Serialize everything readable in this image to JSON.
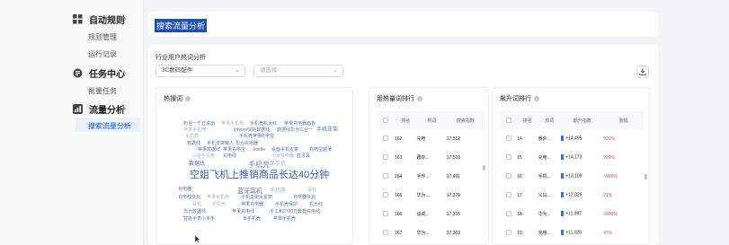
{
  "sidebar": {
    "sections": [
      {
        "label": "自动规则",
        "items": [
          "规则管理",
          "运行记录"
        ]
      },
      {
        "label": "任务中心",
        "items": [
          "批量任务"
        ]
      },
      {
        "label": "流量分析",
        "items": [
          "搜索流量分析"
        ]
      }
    ]
  },
  "header": {
    "title": "搜索流量分析"
  },
  "main": {
    "section_label": "行业用户热词分析",
    "category_select": "3C数码配件",
    "sub_select_placeholder": "请选择",
    "hot_words_title": "热搜词",
    "hot_words": [
      {
        "text": "粉丝一千万漫画",
        "size": 5,
        "color": "#5b73b8"
      },
      {
        "text": "苹果手机壳",
        "size": 5,
        "color": "#a9b4d6"
      },
      {
        "text": "手机壳机大红",
        "size": 5,
        "color": "#5b73b8"
      },
      {
        "text": "苹果充电器面板",
        "size": 5,
        "color": "#5b73b8"
      },
      {
        "text": "手机支架",
        "size": 6,
        "color": "#5b73b8"
      },
      {
        "text": "苹果手机壳",
        "size": 5,
        "color": "#a9b4d6"
      },
      {
        "text": "iphone快充数据线",
        "size": 5,
        "color": "#5b73b8"
      },
      {
        "text": "数据线华为三合一",
        "size": 5,
        "color": "#5b73b8"
      },
      {
        "text": "手机膜",
        "size": 5,
        "color": "#a9b4d6"
      },
      {
        "text": "手机壳苹果",
        "size": 5,
        "color": "#5b73b8"
      },
      {
        "text": "充电宝",
        "size": 5,
        "color": "#5b73b8"
      },
      {
        "text": "数据线",
        "size": 5,
        "color": "#5b73b8"
      },
      {
        "text": "手机支架懒人",
        "size": 5,
        "color": "#5b73b8"
      },
      {
        "text": "华为充电器",
        "size": 5,
        "color": "#5b73b8"
      },
      {
        "text": "苹果数据线",
        "size": 5,
        "color": "#5b73b8"
      },
      {
        "text": "苹果充电宝",
        "size": 5,
        "color": "#5b73b8"
      },
      {
        "text": "kindle",
        "size": 5,
        "color": "#5b73b8"
      },
      {
        "text": "桌面手机支架",
        "size": 5,
        "color": "#5b73b8"
      },
      {
        "text": "充电宝超薄",
        "size": 5,
        "color": "#5b73b8"
      },
      {
        "text": "三星手机壳",
        "size": 5,
        "color": "#a9b4d6"
      },
      {
        "text": "充电线",
        "size": 5,
        "color": "#5b73b8"
      },
      {
        "text": "小米充电器",
        "size": 5,
        "color": "#a9b4d6"
      },
      {
        "text": "蓝牙耳",
        "size": 5,
        "color": "#5b73b8"
      },
      {
        "text": "数据线",
        "size": 6,
        "color": "#5b73b8"
      },
      {
        "text": "手机壳",
        "size": 8,
        "color": "#6d83c2"
      },
      {
        "text": "苹果手机",
        "size": 6,
        "color": "#a9b4d6"
      },
      {
        "text": "空姐飞机上推销商品长达40分钟",
        "size": 11,
        "color": "#3d5fae"
      },
      {
        "text": "充电器",
        "size": 5,
        "color": "#5b73b8"
      },
      {
        "text": "蓝牙耳机",
        "size": 7,
        "color": "#5b73b8"
      },
      {
        "text": "手机膜",
        "size": 6,
        "color": "#a9b4d6"
      },
      {
        "text": "鼠标",
        "size": 5,
        "color": "#a9b4d6"
      },
      {
        "text": "充电线快充",
        "size": 5,
        "color": "#5b73b8"
      },
      {
        "text": "苹果手机壳",
        "size": 5,
        "color": "#a9b4d6"
      },
      {
        "text": "手机支架大支架",
        "size": 5,
        "color": "#5b73b8"
      },
      {
        "text": "充电器快充",
        "size": 5,
        "color": "#5b73b8"
      },
      {
        "text": "耳机",
        "size": 5,
        "color": "#a9b4d6"
      },
      {
        "text": "手机壳",
        "size": 5,
        "color": "#a9b4d6"
      },
      {
        "text": "苹果充电器",
        "size": 5,
        "color": "#5b73b8"
      },
      {
        "text": "手机壳保护",
        "size": 5,
        "color": "#5b73b8"
      },
      {
        "text": "机大红",
        "size": 5,
        "color": "#5b73b8"
      },
      {
        "text": "华为数据线",
        "size": 5,
        "color": "#5b73b8"
      },
      {
        "text": "苹果充电线",
        "size": 5,
        "color": "#5b73b8"
      },
      {
        "text": "手工和2700万套套充电线",
        "size": 5,
        "color": "#5b73b8"
      },
      {
        "text": "智能手表小米手",
        "size": 5,
        "color": "#5b73b8"
      },
      {
        "text": "单手机壳",
        "size": 5,
        "color": "#5b73b8"
      },
      {
        "text": "苹果手机壳",
        "size": 5,
        "color": "#5b73b8"
      }
    ],
    "search_rank": {
      "title": "用热量词排行",
      "headers": [
        "排名",
        "热词",
        "搜索指数"
      ],
      "rows": [
        {
          "rank": "162",
          "word": "充电",
          "index": "17,512"
        },
        {
          "rank": "163",
          "word": "跟你...",
          "index": "17,510"
        },
        {
          "rank": "164",
          "word": "手作...",
          "index": "17,491"
        },
        {
          "rank": "165",
          "word": "华为...",
          "index": "17,379"
        },
        {
          "rank": "166",
          "word": "谈戒...",
          "index": "17,315"
        },
        {
          "rank": "167",
          "word": "华为...",
          "index": "17,303"
        }
      ]
    },
    "rising_rank": {
      "title": "飙升词排行",
      "headers": [
        "排名",
        "热词",
        "飙升指数",
        "涨幅"
      ],
      "rows": [
        {
          "rank": "14",
          "word": "番外...",
          "index": "+14,495",
          "pct": "500%"
        },
        {
          "rank": "15",
          "word": "充电...",
          "index": "+14,173",
          "pct": "999%"
        },
        {
          "rank": "16",
          "word": "手机...",
          "index": "+13,109",
          "pct": ">999%"
        },
        {
          "rank": "17",
          "word": "义乌...",
          "index": "+12,026",
          "pct": "21%"
        },
        {
          "rank": "18",
          "word": "华为...",
          "index": "+11,997",
          "pct": ">999%"
        },
        {
          "rank": "19",
          "word": "充电...",
          "index": "+11,020",
          "pct": "47%"
        }
      ]
    }
  },
  "colors": {
    "accent": "#1a56d6",
    "positive": "#d9534f",
    "bar": "#2f6fe8"
  }
}
